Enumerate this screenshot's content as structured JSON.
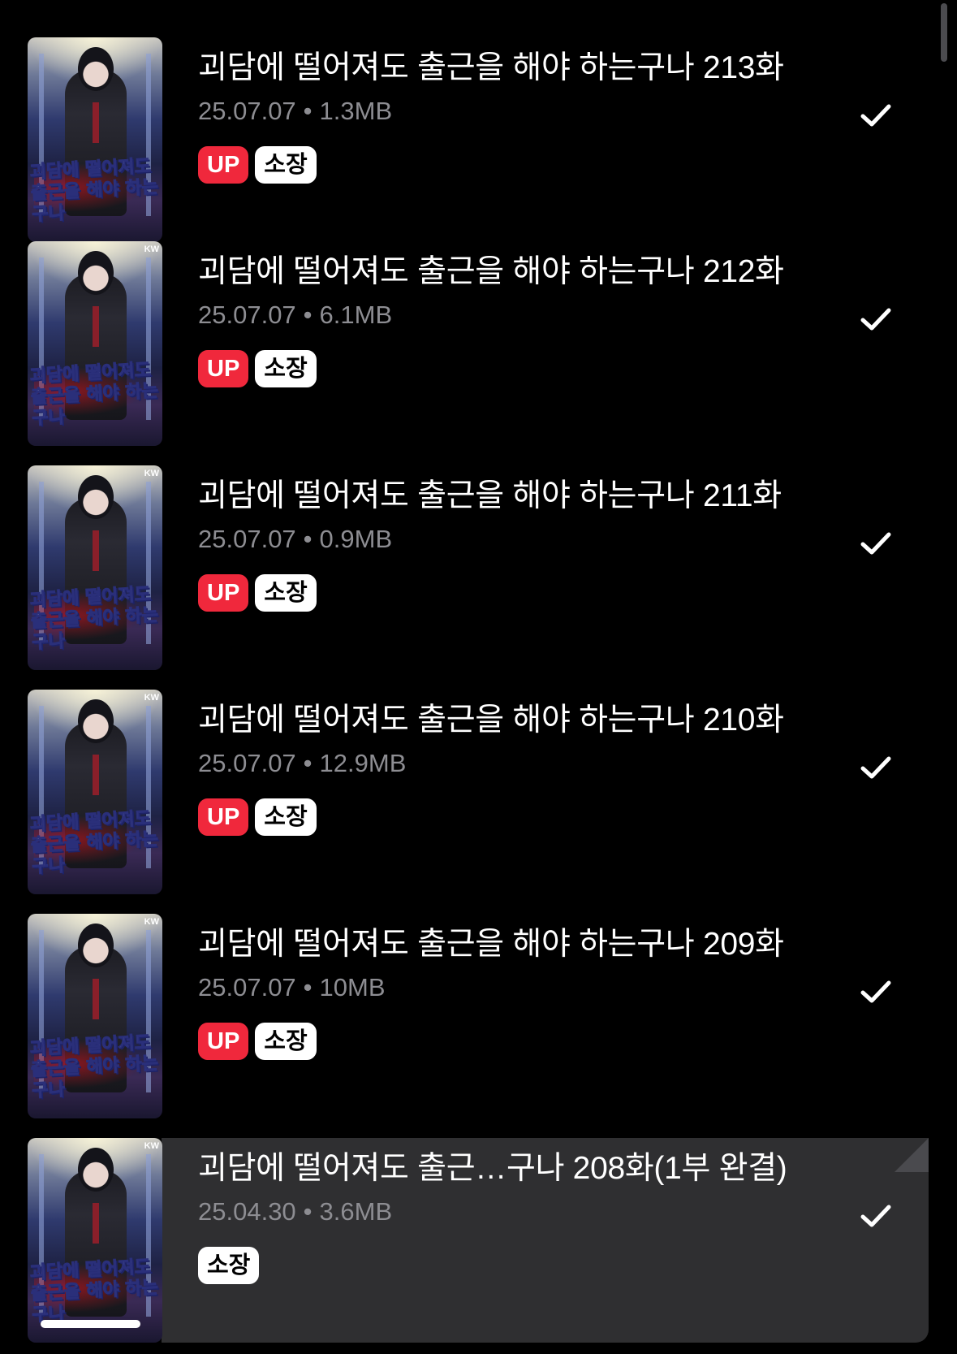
{
  "episodes": [
    {
      "title": "괴담에 떨어져도 출근을 해야 하는구나 213화",
      "date": "25.07.07",
      "size": "1.3MB",
      "separator": "•",
      "badges": {
        "up": "UP",
        "owned": "소장"
      },
      "cover": {
        "title": "괴담에 떨어져도 출근을 해야 하는구나",
        "mark": ""
      },
      "checked": true,
      "highlighted": false
    },
    {
      "title": "괴담에 떨어져도 출근을 해야 하는구나 212화",
      "date": "25.07.07",
      "size": "6.1MB",
      "separator": "•",
      "badges": {
        "up": "UP",
        "owned": "소장"
      },
      "cover": {
        "title": "괴담에 떨어져도 출근을 해야 하는구나",
        "mark": "KW"
      },
      "checked": true,
      "highlighted": false
    },
    {
      "title": "괴담에 떨어져도 출근을 해야 하는구나 211화",
      "date": "25.07.07",
      "size": "0.9MB",
      "separator": "•",
      "badges": {
        "up": "UP",
        "owned": "소장"
      },
      "cover": {
        "title": "괴담에 떨어져도 출근을 해야 하는구나",
        "mark": "KW"
      },
      "checked": true,
      "highlighted": false
    },
    {
      "title": "괴담에 떨어져도 출근을 해야 하는구나 210화",
      "date": "25.07.07",
      "size": "12.9MB",
      "separator": "•",
      "badges": {
        "up": "UP",
        "owned": "소장"
      },
      "cover": {
        "title": "괴담에 떨어져도 출근을 해야 하는구나",
        "mark": "KW"
      },
      "checked": true,
      "highlighted": false
    },
    {
      "title": "괴담에 떨어져도 출근을 해야 하는구나 209화",
      "date": "25.07.07",
      "size": "10MB",
      "separator": "•",
      "badges": {
        "up": "UP",
        "owned": "소장"
      },
      "cover": {
        "title": "괴담에 떨어져도 출근을 해야 하는구나",
        "mark": "KW"
      },
      "checked": true,
      "highlighted": false
    },
    {
      "title": "괴담에 떨어져도 출근…구나 208화(1부 완결)",
      "date": "25.04.30",
      "size": "3.6MB",
      "separator": "•",
      "badges": {
        "owned": "소장"
      },
      "cover": {
        "title": "괴담에 떨어져도 출근을 해야 하는구나",
        "mark": "KW"
      },
      "checked": true,
      "highlighted": true,
      "read_progress": 0.74
    }
  ],
  "colors": {
    "background": "#000000",
    "title": "#ffffff",
    "meta": "#8d8d92",
    "badge_up": "#f0283c",
    "badge_owned": "#ffffff",
    "highlight_row": "#2f2f31"
  },
  "icons": {
    "check": "checkmark-icon",
    "scrollbar": "scrollbar"
  }
}
